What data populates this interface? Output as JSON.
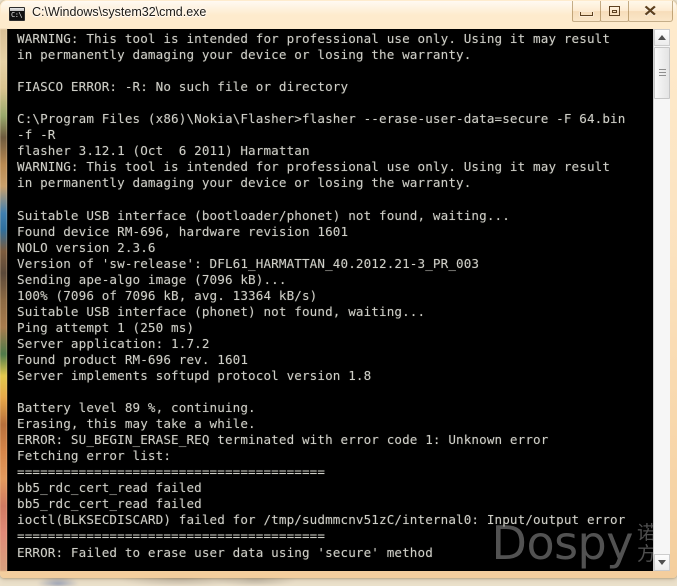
{
  "window": {
    "title": "C:\\Windows\\system32\\cmd.exe",
    "icon_prompt": "C:\\",
    "icon_name": "cmd-exe-icon",
    "minimize_label": "Minimize",
    "maximize_label": "Maximize",
    "close_label": "Close",
    "close_glyph": "✕"
  },
  "colors": {
    "frame": "#fce2be",
    "client_bg": "#000000",
    "console_fg": "#cfcfc8",
    "title_fg": "#1d1a15",
    "watermark": "#5a5a5a"
  },
  "console": {
    "lines": [
      "WARNING: This tool is intended for professional use only. Using it may result",
      "in permanently damaging your device or losing the warranty.",
      "",
      "FIASCO ERROR: -R: No such file or directory",
      "",
      "C:\\Program Files (x86)\\Nokia\\Flasher>flasher --erase-user-data=secure -F 64.bin",
      "-f -R",
      "flasher 3.12.1 (Oct  6 2011) Harmattan",
      "WARNING: This tool is intended for professional use only. Using it may result",
      "in permanently damaging your device or losing the warranty.",
      "",
      "Suitable USB interface (bootloader/phonet) not found, waiting...",
      "Found device RM-696, hardware revision 1601",
      "NOLO version 2.3.6",
      "Version of 'sw-release': DFL61_HARMATTAN_40.2012.21-3_PR_003",
      "Sending ape-algo image (7096 kB)...",
      "100% (7096 of 7096 kB, avg. 13364 kB/s)",
      "Suitable USB interface (phonet) not found, waiting...",
      "Ping attempt 1 (250 ms)",
      "Server application: 1.7.2",
      "Found product RM-696 rev. 1601",
      "Server implements softupd protocol version 1.8",
      "",
      "Battery level 89 %, continuing.",
      "Erasing, this may take a while.",
      "ERROR: SU_BEGIN_ERASE_REQ terminated with error code 1: Unknown error",
      "Fetching error list:",
      "========================================",
      "bb5_rdc_cert_read failed",
      "bb5_rdc_cert_read failed",
      "ioctl(BLKSECDISCARD) failed for /tmp/sudmmcnv51zC/internal0: Input/output error",
      "========================================",
      "ERROR: Failed to erase user data using 'secure' method"
    ]
  },
  "watermark": {
    "latin": "Dospy",
    "cjk_line1": "诺",
    "cjk_line2": "方"
  },
  "scrollbar": {
    "up_label": "Scroll up",
    "down_label": "Scroll down",
    "thumb_label": "Scroll thumb"
  }
}
